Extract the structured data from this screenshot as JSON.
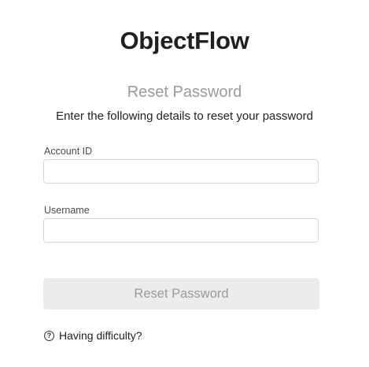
{
  "app": {
    "brand": "ObjectFlow"
  },
  "form": {
    "title": "Reset Password",
    "subtitle": "Enter the following details to reset your password",
    "account_id": {
      "label": "Account ID",
      "value": "",
      "placeholder": ""
    },
    "username": {
      "label": "Username",
      "value": "",
      "placeholder": ""
    },
    "submit_label": "Reset Password",
    "help": {
      "icon": "question-circle-icon",
      "icon_glyph": "?",
      "label": "Having difficulty?"
    }
  },
  "colors": {
    "title": "#9a9a9a",
    "button_bg": "#ececec",
    "button_text": "#9b9b9b",
    "input_border": "#d6d6d6"
  }
}
